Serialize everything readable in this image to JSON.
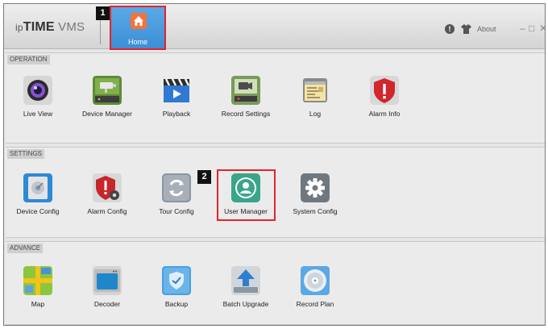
{
  "app": {
    "brand_ip": "ip",
    "brand_time": "TIME",
    "brand_vms": " VMS",
    "home_tab": "Home",
    "about": "About",
    "window_controls": {
      "minimize": "–",
      "maximize": "□",
      "close": "✕"
    }
  },
  "callouts": [
    "1",
    "2"
  ],
  "sections": {
    "operation": {
      "label": "OPERATION",
      "items": [
        "Live View",
        "Device Manager",
        "Playback",
        "Record Settings",
        "Log",
        "Alarm Info"
      ]
    },
    "settings": {
      "label": "SETTINGS",
      "items": [
        "Device Config",
        "Alarm Config",
        "Tour Config",
        "User Manager",
        "System Config"
      ]
    },
    "advance": {
      "label": "ADVANCE",
      "items": [
        "Map",
        "Decoder",
        "Backup",
        "Batch Upgrade",
        "Record Plan"
      ]
    }
  },
  "icons": {
    "operation": [
      "camera-lens-icon",
      "cctv-camera-icon",
      "clapperboard-icon",
      "record-settings-icon",
      "log-icon",
      "alarm-shield-icon"
    ],
    "settings": [
      "device-config-icon",
      "alarm-config-icon",
      "tour-refresh-icon",
      "user-icon",
      "system-gear-icon"
    ],
    "advance": [
      "map-icon",
      "decoder-icon",
      "backup-shield-icon",
      "upload-icon",
      "record-disc-icon"
    ]
  },
  "colors": {
    "highlight": "#e0252b",
    "home_tab": "#3c8ed6",
    "home_icon": "#f2743a"
  }
}
